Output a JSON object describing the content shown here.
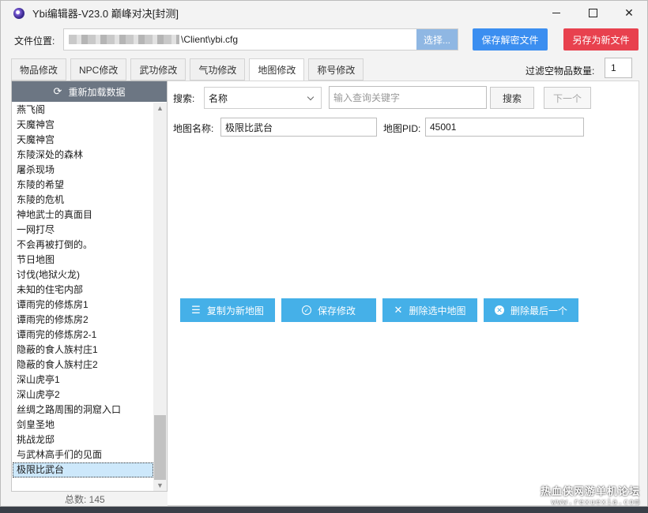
{
  "window": {
    "title": "Ybi编辑器-V23.0 巅峰对决[封测]"
  },
  "file": {
    "label": "文件位置:",
    "path_suffix": "\\Client\\ybi.cfg",
    "choose_label": "选择..."
  },
  "buttons": {
    "save_decrypt": "保存解密文件",
    "save_as_new": "另存为新文件"
  },
  "tabs": [
    "物品修改",
    "NPC修改",
    "武功修改",
    "气功修改",
    "地图修改",
    "称号修改"
  ],
  "active_tab": 4,
  "filter": {
    "label": "过滤空物品数量:",
    "value": "1"
  },
  "left": {
    "reload_label": "重新加载数据",
    "items": [
      "燕飞阁",
      "天魔神宫",
      "天魔神宫",
      "东陵深处的森林",
      "屠杀现场",
      "东陵的希望",
      "东陵的危机",
      "神地武士的真面目",
      "一网打尽",
      "不会再被打倒的。",
      "节日地图",
      "讨伐(地狱火龙)",
      "未知的住宅内部",
      "谭雨完的修炼房1",
      "谭雨完的修炼房2",
      "谭雨完的修炼房2-1",
      "隐蔽的食人族村庄1",
      "隐蔽的食人族村庄2",
      "深山虎亭1",
      "深山虎亭2",
      "丝绸之路周围的洞窟入口",
      "剑皇圣地",
      "挑战龙邸",
      "与武林高手们的见面",
      "极限比武台"
    ],
    "selected_index": 24,
    "total": "总数:  145"
  },
  "search": {
    "label": "搜索:",
    "field_value": "名称",
    "placeholder": "输入查询关键字",
    "search_label": "搜索",
    "next_label": "下一个"
  },
  "map": {
    "name_label": "地图名称:",
    "name_value": "极限比武台",
    "pid_label": "地图PID:",
    "pid_value": "45001"
  },
  "actions": {
    "copy": "复制为新地图",
    "save": "保存修改",
    "delete_selected": "删除选中地图",
    "delete_last": "删除最后一个"
  },
  "watermark": {
    "line1": "热血侠网游单机论坛",
    "line2": "www.rexuexia.com"
  }
}
